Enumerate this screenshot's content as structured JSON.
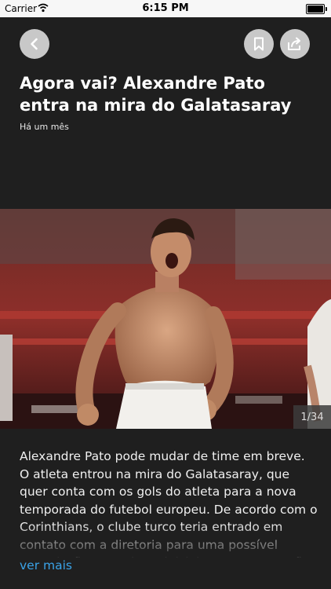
{
  "status_bar": {
    "carrier": "Carrier",
    "time": "6:15 PM"
  },
  "article": {
    "title": "Agora vai? Alexandre Pato entra na mira do Galatasaray",
    "date": "Há um mês",
    "gallery_counter": "1/34",
    "body": "Alexandre Pato pode mudar de time em breve. O atleta entrou na mira do Galatasaray, que quer conta com os gols do atleta para a nova temporada do futebol europeu. De acordo com o Corinthians, o clube turco teria entrado em contato com a diretoria para uma possível negociação. Os valores iniciais, no entanto, não",
    "read_more": "ver mais"
  },
  "icons": {
    "back": "chevron-left-icon",
    "bookmark": "bookmark-icon",
    "share": "share-icon"
  },
  "colors": {
    "background": "#1f1f1f",
    "link": "#3aa3e8",
    "button": "#c8c8c8"
  }
}
